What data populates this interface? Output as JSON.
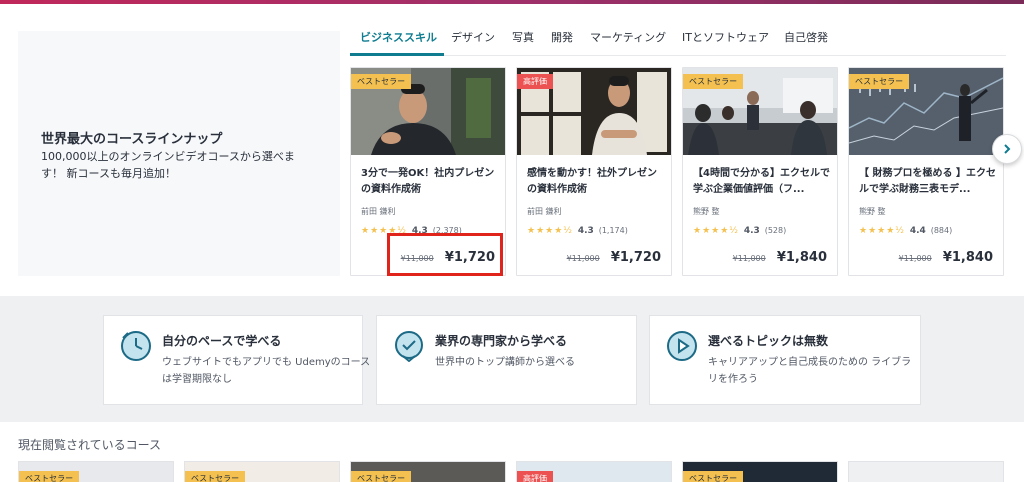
{
  "promo": {
    "title": "世界最大のコースラインナップ",
    "subtitle": "100,000以上のオンラインビデオコースから選べま す！ 新コースも毎月追加！"
  },
  "tabs": [
    "ビジネススキル",
    "デザイン",
    "写真",
    "開発",
    "マーケティング",
    "ITとソフトウェア",
    "自己啓発"
  ],
  "courses": [
    {
      "badge": "ベストセラー",
      "title": "3分で一発OK！社内プレゼンの資料作成術",
      "author": "前田 鎌利",
      "stars": "★★★★½",
      "rating": "4.3",
      "count": "(2,378)",
      "old_price": "¥11,000",
      "price": "¥1,720"
    },
    {
      "badge": "高評価",
      "title": "感情を動かす！社外プレゼンの資料作成術",
      "author": "前田 鎌利",
      "stars": "★★★★½",
      "rating": "4.3",
      "count": "(1,174)",
      "old_price": "¥11,000",
      "price": "¥1,720"
    },
    {
      "badge": "ベストセラー",
      "title": "【4時間で分かる】エクセルで学ぶ企業価値評価（フ...",
      "author": "熊野 整",
      "stars": "★★★★½",
      "rating": "4.3",
      "count": "(528)",
      "old_price": "¥11,000",
      "price": "¥1,840"
    },
    {
      "badge": "ベストセラー",
      "title": "【 財務プロを極める 】エクセルで学ぶ財務三表モデ...",
      "author": "熊野 整",
      "stars": "★★★★½",
      "rating": "4.4",
      "count": "(884)",
      "old_price": "¥11,000",
      "price": "¥1,840"
    }
  ],
  "features": [
    {
      "title": "自分のペースで学べる",
      "desc": "ウェブサイトでもアプリでも Udemyのコースは学習期限なし",
      "icon": "clock-icon"
    },
    {
      "title": "業界の専門家から学べる",
      "desc": "世界中のトップ講師から選べる",
      "icon": "check-badge-icon"
    },
    {
      "title": "選べるトピックは無数",
      "desc": "キャリアアップと自己成長のための ライブラリを作ろう",
      "icon": "play-icon"
    }
  ],
  "section": {
    "title": "現在閲覧されているコース"
  },
  "bottom_badges": [
    "ベストセラー",
    "ベストセラー",
    "ベストセラー",
    "高評価",
    "ベストセラー"
  ],
  "colors": {
    "accent": "#0f7c90",
    "bestseller": "#f4c150",
    "highrated": "#ec5252",
    "highlight": "#e0241c"
  }
}
